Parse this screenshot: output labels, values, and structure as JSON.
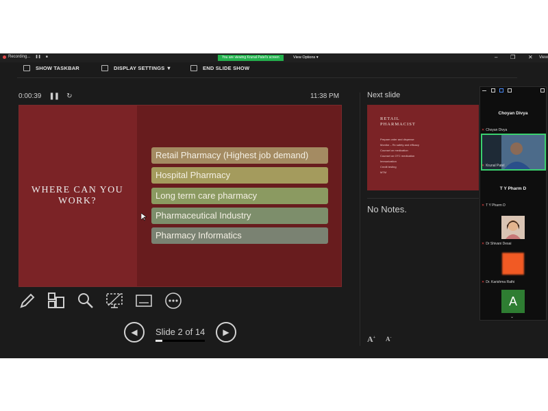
{
  "topbar": {
    "recording_label": "Recording...",
    "viewing_banner": "You are viewing Krunal Patel's screen",
    "view_options": "View Options ▾",
    "view_right": "View"
  },
  "toolbar": {
    "show_taskbar": "SHOW TASKBAR",
    "display_settings": "DISPLAY SETTINGS ▼",
    "end_slide_show": "END SLIDE SHOW"
  },
  "presenter": {
    "elapsed": "0:00:39",
    "clock": "11:38 PM",
    "slide_counter": "Slide 2 of 14",
    "progress_fraction": 0.143,
    "next_slide_label": "Next slide",
    "notes": "No Notes."
  },
  "slide": {
    "heading": "WHERE CAN YOU WORK?",
    "options": [
      {
        "text": "Retail Pharmacy (Highest job demand)",
        "color": "#a48b62"
      },
      {
        "text": "Hospital Pharmacy",
        "color": "#a49b5d"
      },
      {
        "text": "Long term care pharmacy",
        "color": "#8b9a61"
      },
      {
        "text": "Pharmaceutical Industry",
        "color": "#7d8e6b"
      },
      {
        "text": "Pharmacy Informatics",
        "color": "#7a8272"
      }
    ]
  },
  "next_slide": {
    "title": "RETAIL PHARMACIST",
    "bullets": [
      "Prepare order and dispense",
      "Monitor – Rx safety and efficacy",
      "Counsel on medication",
      "Counsel on OTC medication",
      "Immunization",
      "Credit testing",
      "MTM"
    ]
  },
  "participants": [
    {
      "name": "Choyan Divya",
      "label": "Choyan Divya"
    },
    {
      "name": "",
      "label": "Krunal Patel"
    },
    {
      "name": "T Y Pharm D",
      "label": "T Y Pharm D"
    },
    {
      "name": "",
      "label": "Dr Shivani Desai"
    },
    {
      "name": "",
      "label": "Dr. Karishma Rathi"
    },
    {
      "name": "A",
      "label": ""
    }
  ],
  "colors": {
    "slide_bg": "#681c1e",
    "slide_panel": "#7b2326",
    "banner": "#23b14d"
  }
}
